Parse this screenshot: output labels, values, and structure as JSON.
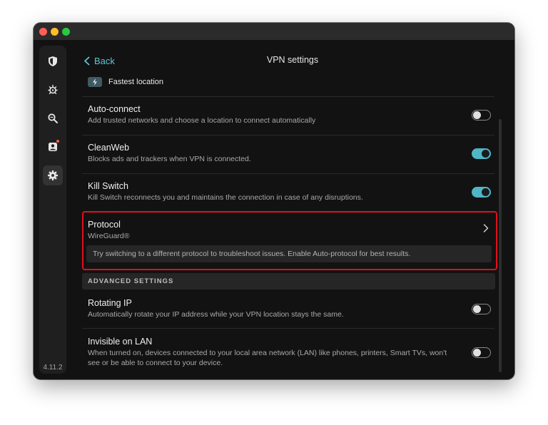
{
  "header": {
    "back_label": "Back",
    "title": "VPN settings"
  },
  "sidebar": {
    "items": [
      {
        "icon": "shield-icon"
      },
      {
        "icon": "virus-icon"
      },
      {
        "icon": "search-icon"
      },
      {
        "icon": "profile-icon",
        "has_notification": true
      },
      {
        "icon": "gear-icon",
        "active": true
      }
    ],
    "version": "4.11.2"
  },
  "location": {
    "label": "Fastest location",
    "icon": "lightning-icon"
  },
  "settings": {
    "auto_connect": {
      "title": "Auto-connect",
      "description": "Add trusted networks and choose a location to connect automatically",
      "enabled": false
    },
    "cleanweb": {
      "title": "CleanWeb",
      "description": "Blocks ads and trackers when VPN is connected.",
      "enabled": true
    },
    "kill_switch": {
      "title": "Kill Switch",
      "description": "Kill Switch reconnects you and maintains the connection in case of any disruptions.",
      "enabled": true
    },
    "protocol": {
      "title": "Protocol",
      "value": "WireGuard®",
      "hint": "Try switching to a different protocol to troubleshoot issues. Enable Auto-protocol for best results."
    }
  },
  "advanced": {
    "header": "ADVANCED SETTINGS",
    "rotating_ip": {
      "title": "Rotating IP",
      "description": "Automatically rotate your IP address while your VPN location stays the same.",
      "enabled": false
    },
    "invisible_lan": {
      "title": "Invisible on LAN",
      "description_line1": "When turned on, devices connected to your local area network (LAN) like phones, printers, Smart TVs, won't",
      "description_line2": "see or be able to connect to your device.",
      "enabled": false
    }
  },
  "colors": {
    "accent": "#4fb6c7",
    "highlight": "#e0101f",
    "background": "#121212"
  }
}
